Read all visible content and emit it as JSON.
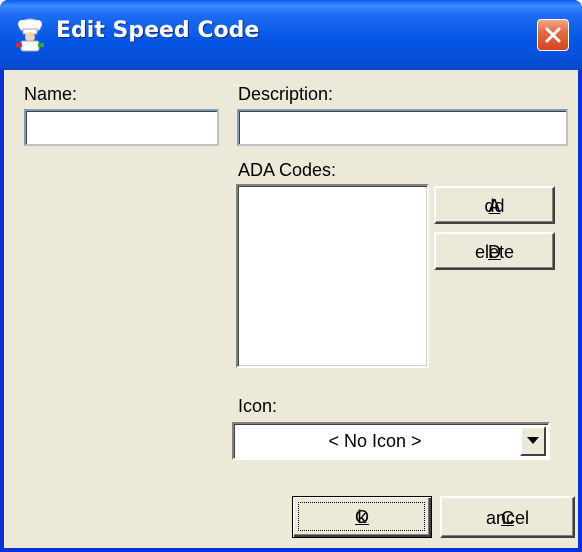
{
  "window": {
    "title": "Edit Speed Code",
    "icon": "chef-icon",
    "close_icon": "close-icon"
  },
  "form": {
    "name_label": "Name:",
    "name_value": "",
    "description_label": "Description:",
    "description_value": "",
    "ada_codes_label": "ADA Codes:",
    "ada_codes": [],
    "icon_label": "Icon:",
    "icon_selected": "< No Icon >"
  },
  "buttons": {
    "add_prefix": "",
    "add_underline": "A",
    "add_rest": "dd",
    "delete_prefix": "",
    "delete_underline": "D",
    "delete_rest": "elete",
    "ok_prefix": "",
    "ok_underline": "O",
    "ok_rest": "k",
    "cancel_prefix": "",
    "cancel_underline": "C",
    "cancel_rest": "ancel"
  },
  "colors": {
    "titlebar": "#0756e6",
    "close_button": "#d2461c",
    "dialog_face": "#ece9d8"
  }
}
